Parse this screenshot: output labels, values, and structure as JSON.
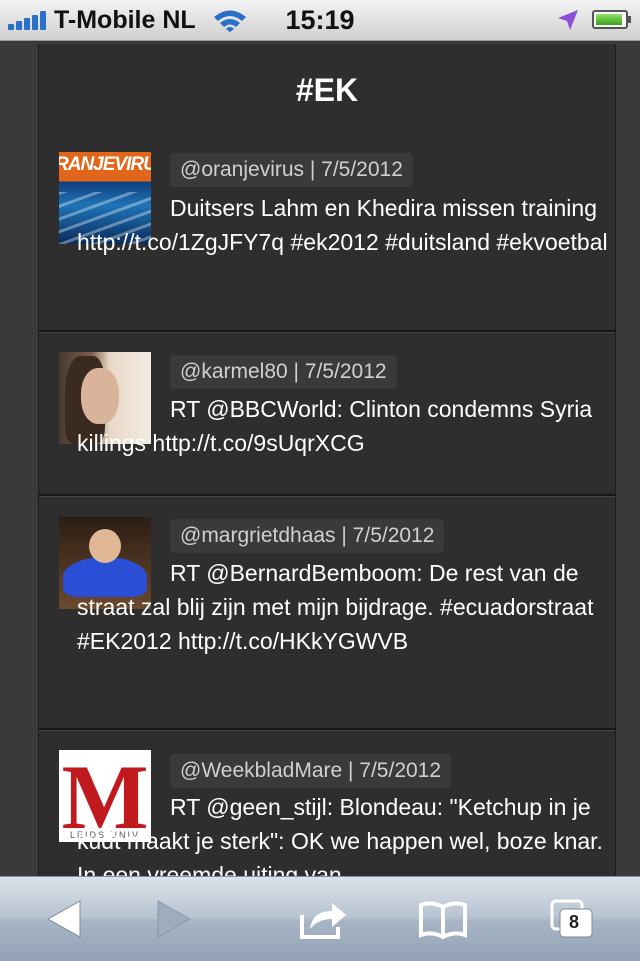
{
  "status_bar": {
    "carrier": "T-Mobile NL",
    "time": "15:19"
  },
  "page": {
    "title": "#EK"
  },
  "tweets": [
    {
      "meta": "@oranjevirus | 7/5/2012",
      "text": "Duitsers Lahm en Khedira missen training http://t.co/1ZgJFY7q #ek2012 #duitsland #ekvoetbal",
      "avatar_text": "RANJEVIRU"
    },
    {
      "meta": "@karmel80 | 7/5/2012",
      "text": "RT @BBCWorld: Clinton condemns Syria killings http://t.co/9sUqrXCG"
    },
    {
      "meta": "@margrietdhaas | 7/5/2012",
      "text": "RT @BernardBemboom: De rest van de straat zal blij zijn met mijn bijdrage. #ecuadorstraat #EK2012 http://t.co/HKkYGWVB"
    },
    {
      "meta": "@WeekbladMare | 7/5/2012",
      "text": "RT @geen_stijl: Blondeau: \"Ketchup in je kudt maakt je sterk\": OK we happen wel, boze knar. In een vreemde uiting van",
      "avatar_text": "M",
      "avatar_sub": "LEIDS UNIV"
    }
  ],
  "toolbar": {
    "tab_count": "8",
    "icons": [
      "back-arrow-icon",
      "forward-arrow-icon",
      "share-icon",
      "bookmarks-book-icon",
      "tabs-pages-icon"
    ]
  },
  "colors": {
    "background": "#3a3a3a",
    "panel": "#2e2e2e",
    "meta_bg": "#3a3a3a",
    "signal_blue": "#2a70c9",
    "location_purple": "#8a4fd8",
    "battery_green": "#3aa219"
  }
}
